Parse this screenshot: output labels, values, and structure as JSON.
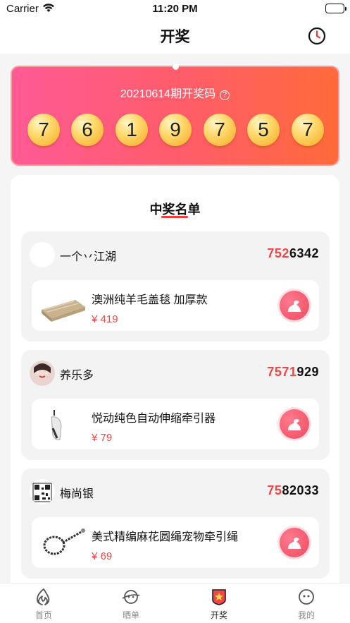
{
  "status_bar": {
    "carrier": "Carrier",
    "time": "11:20 PM"
  },
  "nav": {
    "title": "开奖",
    "history_icon": "clock-icon"
  },
  "draw": {
    "period_label": "20210614期开奖码",
    "help_glyph": "?",
    "numbers": [
      "7",
      "6",
      "1",
      "9",
      "7",
      "5",
      "7"
    ]
  },
  "winners": {
    "heading": "中奖名单",
    "entries": [
      {
        "name": "一个丷江湖",
        "code_highlight": "752",
        "code_rest": "6342",
        "prize": {
          "name": "澳洲纯羊毛盖毯 加厚款",
          "price": "¥ 419"
        }
      },
      {
        "name": "养乐多",
        "code_highlight": "7571",
        "code_rest": "929",
        "prize": {
          "name": "悦动纯色自动伸缩牵引器",
          "price": "¥ 79"
        }
      },
      {
        "name": "梅尚银",
        "code_highlight": "75",
        "code_rest": "82033",
        "prize": {
          "name": "美式精编麻花圆绳宠物牵引绳",
          "price": "¥ 69"
        }
      }
    ]
  },
  "tabbar": {
    "items": [
      {
        "label": "首页",
        "icon": "flame-icon"
      },
      {
        "label": "晒单",
        "icon": "planet-face-icon"
      },
      {
        "label": "开奖",
        "icon": "star-shield-icon"
      },
      {
        "label": "我的",
        "icon": "smiley-icon"
      }
    ],
    "active": "开奖"
  },
  "colors": {
    "accent": "#f04646",
    "gradient_start": "#ff5a95",
    "gradient_end": "#ff6a3a",
    "ball": "#ffd86a"
  }
}
